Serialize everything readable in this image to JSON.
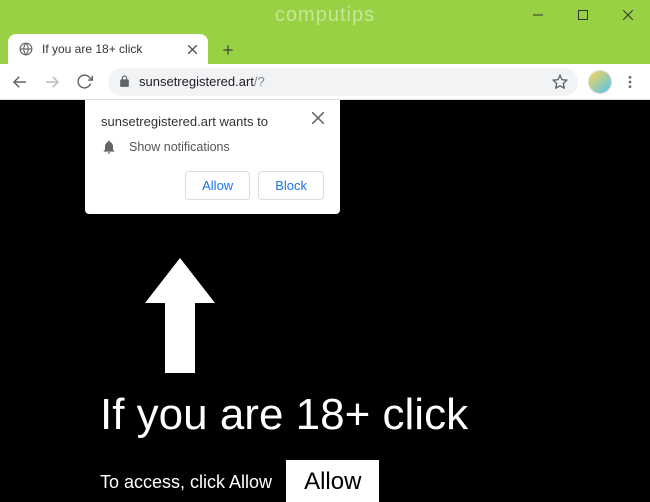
{
  "window": {
    "watermark": "computips"
  },
  "tab": {
    "title": "If you are 18+ click"
  },
  "toolbar": {
    "url_host": "sunsetregistered.art",
    "url_path": "/?"
  },
  "popup": {
    "title": "sunsetregistered.art wants to",
    "permission_label": "Show notifications",
    "allow_label": "Allow",
    "block_label": "Block"
  },
  "page": {
    "headline": "If you are 18+ click",
    "subline": "To access, click Allow",
    "allow_button": "Allow"
  }
}
